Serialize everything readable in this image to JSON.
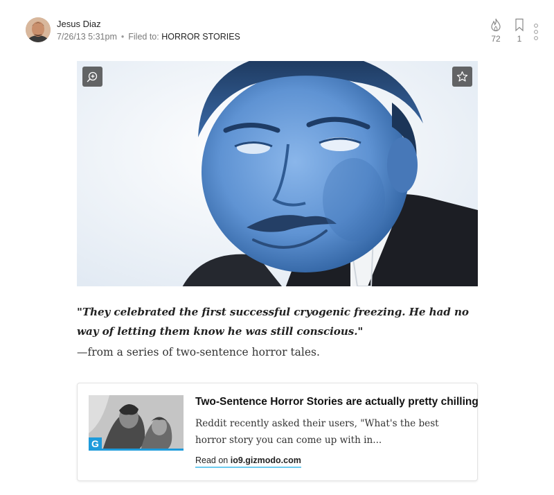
{
  "author": {
    "name": "Jesus Diaz",
    "timestamp": "7/26/13 5:31pm",
    "filed_label": "Filed to:",
    "filed_tag": "HORROR STORIES"
  },
  "stats": {
    "flame_count": "72",
    "bookmark_count": "1"
  },
  "article": {
    "quote": "\"They celebrated the first successful cryogenic freezing. He had no way of letting them know he was still conscious.\"",
    "attribution": "—from a series of two-sentence horror tales."
  },
  "link_card": {
    "badge": "G",
    "title": "Two-Sentence Horror Stories are actually pretty chilling",
    "description": "Reddit recently asked their users, \"What's the best horror story you can come up with in...",
    "read_on_label": "Read on",
    "domain": "io9.gizmodo.com"
  },
  "icons": {
    "flame": "flame-icon",
    "bookmark": "bookmark-icon",
    "more": "more-vertical-icon",
    "zoom": "zoom-in-icon",
    "star": "star-icon"
  },
  "colors": {
    "accent_blue": "#1e9bdb",
    "link_underline": "#6ccbf0",
    "hero_tint": "#5a8ed0"
  }
}
